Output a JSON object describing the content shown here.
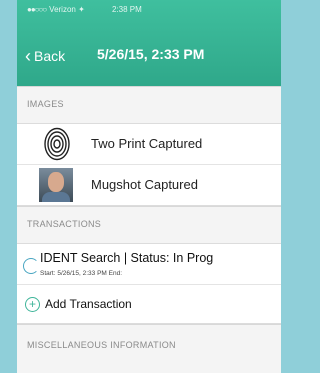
{
  "status": {
    "carrier": "Verizon",
    "time": "2:38 PM"
  },
  "nav": {
    "back_label": "Back",
    "title": "5/26/15, 2:33 PM"
  },
  "images_section": {
    "header": "IMAGES",
    "items": [
      {
        "label": "Two Print Captured",
        "icon": "fingerprint-icon"
      },
      {
        "label": "Mugshot Captured",
        "icon": "mugshot-thumbnail"
      }
    ]
  },
  "transactions_section": {
    "header": "TRANSACTIONS",
    "items": [
      {
        "title": "IDENT Search | Status: In Prog",
        "sub": "Start: 5/26/15, 2:33 PM End:"
      }
    ],
    "add_label": "Add Transaction"
  },
  "next_section": {
    "header": "MISCELLANEOUS INFORMATION"
  },
  "colors": {
    "accent": "#3fbf9e",
    "background": "#8fcfd9"
  }
}
